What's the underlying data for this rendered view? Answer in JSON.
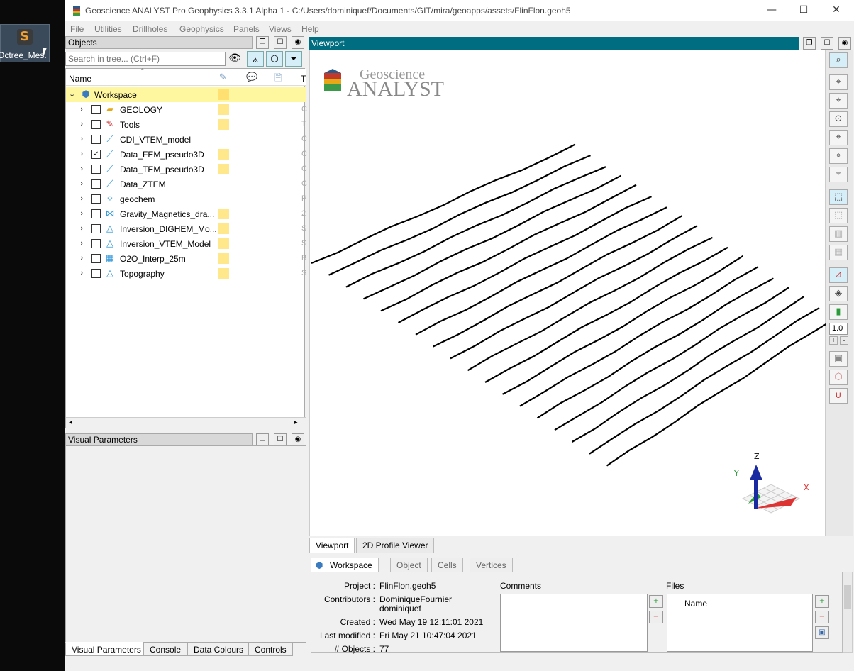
{
  "desktop": {
    "icon_label": "Octree_Mes."
  },
  "window": {
    "title": "Geoscience ANALYST Pro Geophysics 3.3.1 Alpha 1 - C:/Users/dominiquef/Documents/GIT/mira/geoapps/assets/FlinFlon.geoh5",
    "controls": {
      "minimize": "—",
      "maximize": "☐",
      "close": "✕"
    }
  },
  "menu": [
    "File",
    "Utilities",
    "Drillholes",
    "Geophysics",
    "Panels",
    "Views",
    "Help"
  ],
  "objects": {
    "header": "Objects",
    "search_placeholder": "Search in tree... (Ctrl+F)",
    "columns": {
      "name": "Name",
      "t": "T"
    },
    "workspace": "Workspace",
    "items": [
      {
        "label": "GEOLOGY",
        "icon": "folder-icon",
        "glyph": "▰",
        "checked": false,
        "swatch": true,
        "t": "C"
      },
      {
        "label": "Tools",
        "icon": "tools-icon",
        "glyph": "✎",
        "checked": false,
        "swatch": true,
        "t": "T"
      },
      {
        "label": "CDI_VTEM_model",
        "icon": "curve-icon",
        "glyph": "⟋",
        "checked": false,
        "swatch": false,
        "t": "C"
      },
      {
        "label": "Data_FEM_pseudo3D",
        "icon": "curve-icon",
        "glyph": "⟋",
        "checked": true,
        "swatch": true,
        "t": "C"
      },
      {
        "label": "Data_TEM_pseudo3D",
        "icon": "curve-icon",
        "glyph": "⟋",
        "checked": false,
        "swatch": true,
        "t": "C"
      },
      {
        "label": "Data_ZTEM",
        "icon": "curve-icon",
        "glyph": "⟋",
        "checked": false,
        "swatch": false,
        "t": "C"
      },
      {
        "label": "geochem",
        "icon": "points-icon",
        "glyph": "⁘",
        "checked": false,
        "swatch": false,
        "t": "P"
      },
      {
        "label": "Gravity_Magnetics_dra...",
        "icon": "surface-icon",
        "glyph": "⋈",
        "checked": false,
        "swatch": true,
        "t": "2"
      },
      {
        "label": "Inversion_DIGHEM_Mo...",
        "icon": "triangle-icon",
        "glyph": "△",
        "checked": false,
        "swatch": true,
        "t": "S"
      },
      {
        "label": "Inversion_VTEM_Model",
        "icon": "triangle-icon",
        "glyph": "△",
        "checked": false,
        "swatch": true,
        "t": "S"
      },
      {
        "label": "O2O_Interp_25m",
        "icon": "block-icon",
        "glyph": "▦",
        "checked": false,
        "swatch": true,
        "t": "B"
      },
      {
        "label": "Topography",
        "icon": "triangle-icon",
        "glyph": "△",
        "checked": false,
        "swatch": true,
        "t": "S"
      }
    ]
  },
  "visual_parameters": {
    "header": "Visual Parameters"
  },
  "bottom_tabs": [
    "Visual Parameters",
    "Console",
    "Data Colours",
    "Controls"
  ],
  "viewport": {
    "header": "Viewport",
    "logo_top": "Geoscience",
    "logo_bottom": "ANALYST",
    "axis_labels": {
      "z": "Z",
      "y": "Y",
      "x": "X"
    },
    "scale_value": "1.0",
    "scale_plus": "+",
    "scale_minus": "-"
  },
  "viewport_tabs": [
    "Viewport",
    "2D Profile Viewer"
  ],
  "info_tabs": [
    "Workspace",
    "Object",
    "Cells",
    "Vertices"
  ],
  "info": {
    "project_label": "Project :",
    "project": "FlinFlon.geoh5",
    "contributors_label": "Contributors :",
    "contributor_1": "DominiqueFournier",
    "contributor_2": "dominiquef",
    "created_label": "Created :",
    "created": "Wed May 19 12:11:01 2021",
    "modified_label": "Last modified :",
    "modified": "Fri May 21 10:47:04 2021",
    "objects_label": "# Objects :",
    "objects": "77",
    "comments_label": "Comments",
    "files_label": "Files",
    "files_name_col": "Name"
  },
  "colors": {
    "viewport_header": "#006d80",
    "swatch": "#ffe88c",
    "workspace_highlight": "#fff6a0"
  }
}
